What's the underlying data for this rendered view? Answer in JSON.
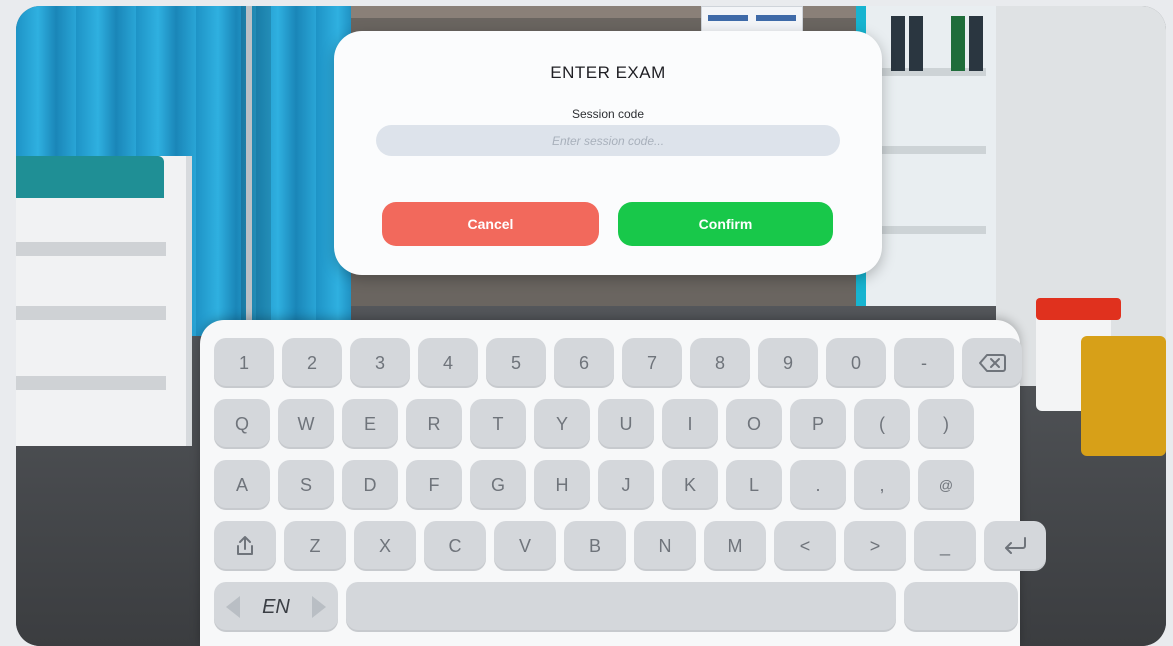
{
  "dialog": {
    "title": "ENTER EXAM",
    "field_label": "Session code",
    "input_placeholder": "Enter session code...",
    "input_value": "",
    "cancel_label": "Cancel",
    "confirm_label": "Confirm"
  },
  "keyboard": {
    "row1": [
      "1",
      "2",
      "3",
      "4",
      "5",
      "6",
      "7",
      "8",
      "9",
      "0",
      "-"
    ],
    "row2": [
      "Q",
      "W",
      "E",
      "R",
      "T",
      "Y",
      "U",
      "I",
      "O",
      "P",
      "(",
      ")"
    ],
    "row3": [
      "A",
      "S",
      "D",
      "F",
      "G",
      "H",
      "J",
      "K",
      "L",
      ".",
      ",",
      "@"
    ],
    "row4": [
      "Z",
      "X",
      "C",
      "V",
      "B",
      "N",
      "M",
      "<",
      ">",
      "_"
    ],
    "language": "EN",
    "icons": [
      "backspace-icon",
      "share-icon",
      "enter-icon",
      "language-prev-icon",
      "language-next-icon"
    ]
  },
  "colors": {
    "cancel": "#f2695c",
    "confirm": "#18c84a",
    "key": "#d4d7db",
    "keyboard_bg": "#f7f8f9",
    "dialog_bg": "#fbfcfd"
  }
}
